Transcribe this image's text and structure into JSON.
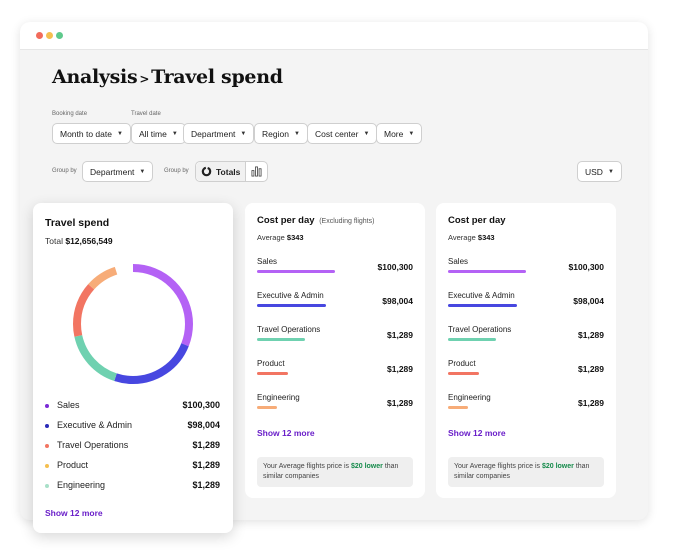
{
  "page": {
    "title_main": "Analysis",
    "title_sep": ">",
    "title_sub": "Travel spend"
  },
  "filters": {
    "booking_date_label": "Booking date",
    "travel_date_label": "Travel date",
    "month_to_date": "Month to date",
    "all_time": "All time",
    "department": "Department",
    "region": "Region",
    "cost_center": "Cost center",
    "more": "More"
  },
  "group_row": {
    "group_by_label_1": "Group by",
    "group_by_value": "Department",
    "group_by_label_2": "Group by",
    "totals_label": "Totals",
    "currency": "USD"
  },
  "colors": {
    "sales": "#b462f5",
    "executive_admin": "#4747e0",
    "travel_operations": "#6fd1b0",
    "product": "#f27562",
    "engineering": "#f7ac78",
    "link": "#6a1fc9",
    "positive": "#148a4a"
  },
  "travel_spend": {
    "title": "Travel spend",
    "total_label": "Total",
    "total_value": "$12,656,549",
    "donut_fractions": [
      0.31,
      0.24,
      0.165,
      0.15,
      0.085
    ],
    "legend": [
      {
        "label": "Sales",
        "value": "$100,300",
        "color": "#7a2bd6"
      },
      {
        "label": "Executive & Admin",
        "value": "$98,004",
        "color": "#2b2bb8"
      },
      {
        "label": "Travel Operations",
        "value": "$1,289",
        "color": "#f27562"
      },
      {
        "label": "Product",
        "value": "$1,289",
        "color": "#f5bf4f"
      },
      {
        "label": "Engineering",
        "value": "$1,289",
        "color": "#a8e0c8"
      }
    ],
    "show_more": "Show 12 more"
  },
  "cost_per_day_1": {
    "title": "Cost per day",
    "subtitle": "(Excluding flights)",
    "average_label": "Average",
    "average_value": "$343",
    "rows": [
      {
        "label": "Sales",
        "value": "$100,300",
        "share": 0.5
      },
      {
        "label": "Executive & Admin",
        "value": "$98,004",
        "share": 0.44
      },
      {
        "label": "Travel Operations",
        "value": "$1,289",
        "share": 0.31
      },
      {
        "label": "Product",
        "value": "$1,289",
        "share": 0.2
      },
      {
        "label": "Engineering",
        "value": "$1,289",
        "share": 0.13
      }
    ],
    "show_more": "Show 12 more",
    "note_prefix": "Your Average flights price is",
    "note_highlight": "$20 lower",
    "note_suffix": "than similar companies"
  },
  "cost_per_day_2": {
    "title": "Cost per day",
    "average_label": "Average",
    "average_value": "$343",
    "rows": [
      {
        "label": "Sales",
        "value": "$100,300",
        "share": 0.5
      },
      {
        "label": "Executive & Admin",
        "value": "$98,004",
        "share": 0.44
      },
      {
        "label": "Travel Operations",
        "value": "$1,289",
        "share": 0.31
      },
      {
        "label": "Product",
        "value": "$1,289",
        "share": 0.2
      },
      {
        "label": "Engineering",
        "value": "$1,289",
        "share": 0.13
      }
    ],
    "show_more": "Show 12 more",
    "note_prefix": "Your Average flights price is",
    "note_highlight": "$20 lower",
    "note_suffix": "than similar companies"
  }
}
